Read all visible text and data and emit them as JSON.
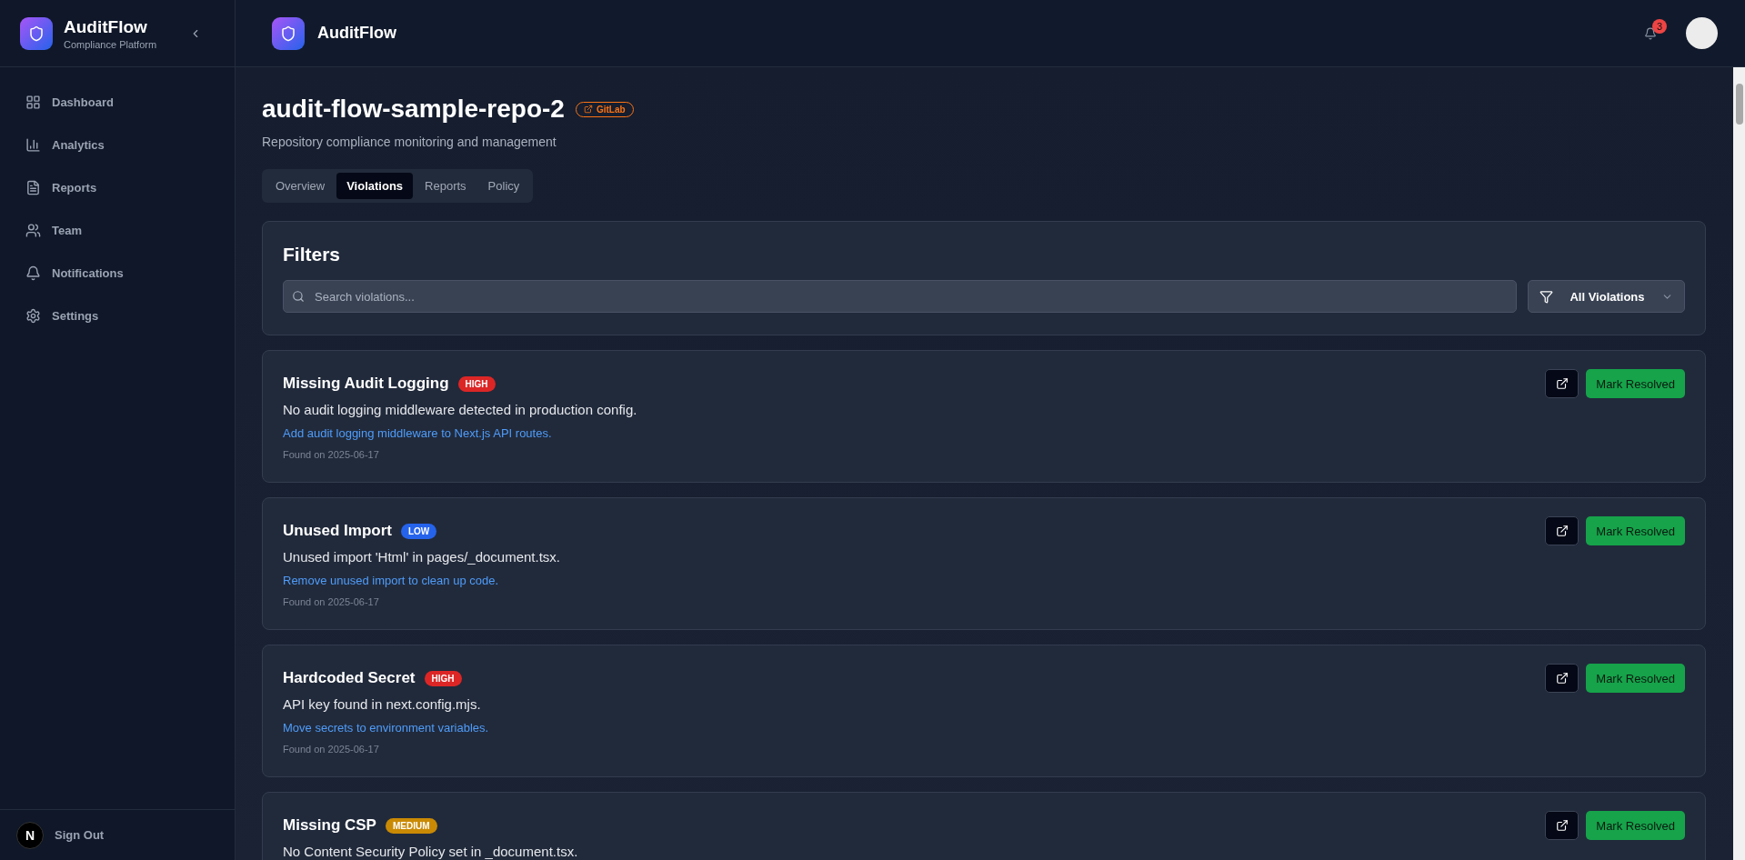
{
  "sidebar": {
    "brand": {
      "name": "AuditFlow",
      "tagline": "Compliance Platform"
    },
    "items": [
      {
        "label": "Dashboard",
        "selected": false
      },
      {
        "label": "Analytics",
        "selected": false
      },
      {
        "label": "Reports",
        "selected": false
      },
      {
        "label": "Team",
        "selected": false
      },
      {
        "label": "Notifications",
        "selected": false
      },
      {
        "label": "Settings",
        "selected": false
      }
    ],
    "footer": {
      "avatar_letter": "N",
      "label": "Sign Out"
    }
  },
  "header": {
    "brand": "AuditFlow",
    "notification_count": "3"
  },
  "repo": {
    "title": "audit-flow-sample-repo-2",
    "provider": "GitLab",
    "subtitle": "Repository compliance monitoring and management"
  },
  "tabs": [
    {
      "label": "Overview",
      "selected": false
    },
    {
      "label": "Violations",
      "selected": true
    },
    {
      "label": "Reports",
      "selected": false
    },
    {
      "label": "Policy",
      "selected": false
    }
  ],
  "filters": {
    "title": "Filters",
    "search": {
      "placeholder": "Search violations..."
    },
    "select": "All Violations"
  },
  "violations": [
    {
      "title": "Missing Audit Logging",
      "badge": "HIGH",
      "color": "#dc2626",
      "description": "No audit logging middleware detected in production config.",
      "fix": "Add audit logging middleware to Next.js API routes.",
      "found": "Found on 2025-06-17",
      "action": "Mark Resolved"
    },
    {
      "title": "Unused Import",
      "badge": "LOW",
      "color": "#2563eb",
      "description": "Unused import 'Html' in pages/_document.tsx.",
      "fix": "Remove unused import to clean up code.",
      "found": "Found on 2025-06-17",
      "action": "Mark Resolved"
    },
    {
      "title": "Hardcoded Secret",
      "badge": "HIGH",
      "color": "#dc2626",
      "description": "API key found in next.config.mjs.",
      "fix": "Move secrets to environment variables.",
      "found": "Found on 2025-06-17",
      "action": "Mark Resolved"
    },
    {
      "title": "Missing CSP",
      "badge": "MEDIUM",
      "color": "#ca8a04",
      "description": "No Content Security Policy set in _document.tsx.",
      "action": "Mark Resolved"
    }
  ]
}
